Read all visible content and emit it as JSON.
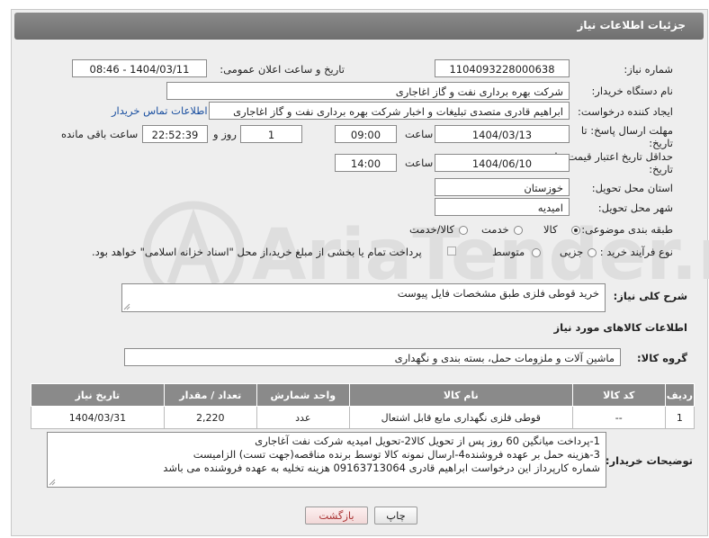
{
  "header": {
    "title": "جزئیات اطلاعات نیاز"
  },
  "form": {
    "need_number": {
      "label": "شماره نیاز:",
      "value": "1104093228000638"
    },
    "announce_datetime": {
      "label": "تاریخ و ساعت اعلان عمومی:",
      "value": "1404/03/11 - 08:46"
    },
    "buyer_org": {
      "label": "نام دستگاه خریدار:",
      "value": "شرکت بهره برداری نفت و گاز اغاجاری"
    },
    "requester": {
      "label": "ایجاد کننده درخواست:",
      "value": "ابراهیم قادری متصدی تبلیغات و اخبار شرکت بهره برداری نفت و گاز اغاجاری",
      "contact_link": "اطلاعات تماس خریدار"
    },
    "reply_deadline": {
      "label": "مهلت ارسال پاسخ: تا تاریخ:",
      "date": "1404/03/13",
      "time_label": "ساعت",
      "time": "09:00",
      "days": "1",
      "days_label": "روز و",
      "remaining": "22:52:39",
      "remaining_label": "ساعت باقی مانده"
    },
    "price_validity": {
      "label": "حداقل تاریخ اعتبار قیمت: تا تاریخ:",
      "date": "1404/06/10",
      "time_label": "ساعت",
      "time": "14:00"
    },
    "province": {
      "label": "استان محل تحویل:",
      "value": "خوزستان"
    },
    "city": {
      "label": "شهر محل تحویل:",
      "value": "امیدیه"
    },
    "category": {
      "label": "طبقه بندی موضوعی:",
      "options": [
        "کالا",
        "خدمت",
        "کالا/خدمت"
      ],
      "selected": "کالا"
    },
    "process": {
      "label": "نوع فرآیند خرید :",
      "options": [
        "جزیی",
        "متوسط"
      ],
      "note": "پرداخت تمام یا بخشی از مبلغ خرید،از محل \"اسناد خزانه اسلامی\" خواهد بود."
    },
    "general_desc": {
      "label": "شرح کلی نیاز:",
      "value": "خرید قوطی فلزی طبق مشخصات فایل پیوست"
    }
  },
  "goods_section": {
    "title": "اطلاعات کالاهای مورد نیاز",
    "group_label": "گروه کالا:",
    "group_value": "ماشین آلات و ملزومات حمل، بسته بندی و نگهداری"
  },
  "table": {
    "headers": [
      "ردیف",
      "کد کالا",
      "نام کالا",
      "واحد شمارش",
      "تعداد / مقدار",
      "تاریخ نیاز"
    ],
    "rows": [
      [
        "1",
        "--",
        "قوطی فلزی نگهداری مایع قابل اشتعال",
        "عدد",
        "2,220",
        "1404/03/31"
      ]
    ]
  },
  "buyer_notes": {
    "label": "توضیحات خریدار:",
    "lines": [
      "1-پرداخت میانگین 60 روز پس از تحویل کالا2-تحویل امیدیه شرکت نفت آغاجاری",
      "3-هزینه حمل بر عهده فروشنده4-ارسال نمونه کالا توسط برنده مناقصه(جهت تست) الزامیست",
      "شماره کارپرداز این درخواست  ابراهیم قادری 09163713064 هزینه تخلیه به عهده فروشنده می باشد"
    ]
  },
  "buttons": {
    "print": "چاپ",
    "back": "بازگشت"
  },
  "watermark": {
    "text": "AriaTender.net"
  }
}
